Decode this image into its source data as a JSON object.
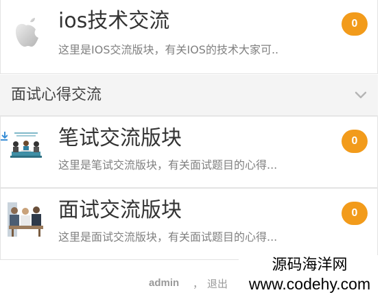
{
  "boards": [
    {
      "title": "ios技术交流",
      "description": "这里是IOS交流版块，有关IOS的技术大家可..",
      "count": "0",
      "icon": "apple-logo-icon"
    }
  ],
  "section": {
    "title": "面试心得交流",
    "icon": "chevron-down-icon",
    "items": [
      {
        "title": "笔试交流版块",
        "description": "这里是笔试交流版块，有关面试题目的心得...",
        "count": "0",
        "icon": "written-test-thumbnail"
      },
      {
        "title": "面试交流版块",
        "description": "这里是面试交流版块，有关面试题目的心得...",
        "count": "0",
        "icon": "interview-thumbnail"
      }
    ]
  },
  "footer": {
    "user": "admin",
    "separator": "，",
    "logout": "退出"
  },
  "watermark": {
    "line1": "源码海洋网",
    "line2": "www.codehy.com"
  },
  "colors": {
    "badge": "#f29b1b",
    "section_bg": "#f4f4f4",
    "title": "#333333",
    "description": "#808080"
  }
}
